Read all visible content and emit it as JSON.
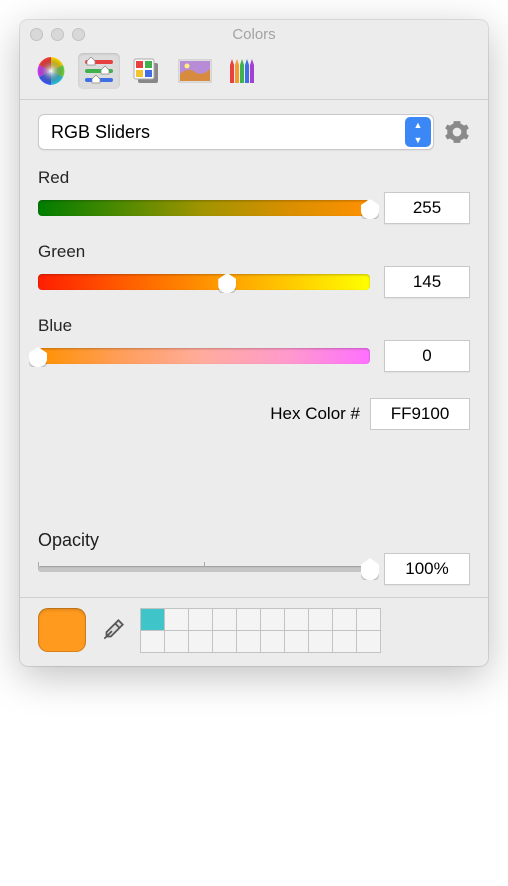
{
  "window": {
    "title": "Colors"
  },
  "mode": {
    "selected": "RGB Sliders"
  },
  "sliders": {
    "red": {
      "label": "Red",
      "value": "255",
      "pct": 100,
      "gradient": "linear-gradient(90deg,#007d00,#4f8a00,#a29400,#d88f00,#ff9100)"
    },
    "green": {
      "label": "Green",
      "value": "145",
      "pct": 57,
      "gradient": "linear-gradient(90deg,#ff1e00,#ff5a00,#ff9100,#ffc800,#ffff00)"
    },
    "blue": {
      "label": "Blue",
      "value": "0",
      "pct": 0,
      "gradient": "linear-gradient(90deg,#ff9100,#ff9e5a,#ffac9e,#ff9acc,#ff70ff)"
    }
  },
  "hex": {
    "label": "Hex Color #",
    "value": "FF9100"
  },
  "opacity": {
    "label": "Opacity",
    "value": "100%",
    "pct": 100
  },
  "current_color": "#ff9a1f",
  "swatches": {
    "first": "#3fc4ca"
  }
}
